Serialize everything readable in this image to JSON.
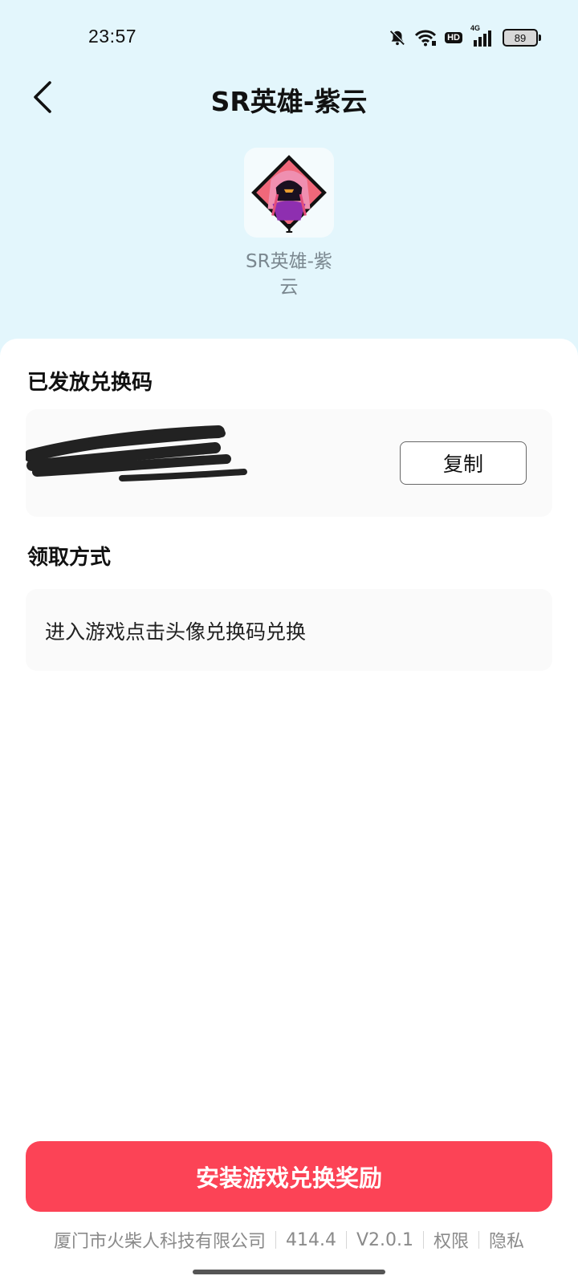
{
  "status_bar": {
    "time": "23:57",
    "network_label": "4G",
    "hd_label": "HD",
    "battery_level": "89",
    "icons": [
      "bell-muted-icon",
      "wifi-icon",
      "hd-icon",
      "signal-4g-icon",
      "battery-icon"
    ]
  },
  "header": {
    "title": "SR英雄-紫云",
    "back_icon": "chevron-left-icon"
  },
  "hero": {
    "badge_count": "1",
    "name": "SR英雄-紫云",
    "colors": {
      "frame": "#111111",
      "bg": "#f0687a",
      "hair": "#ef8fb0",
      "cloth": "#8e2fb0"
    }
  },
  "code_section": {
    "title": "已发放兑换码",
    "copy_label": "复制"
  },
  "method_section": {
    "title": "领取方式",
    "text": "进入游戏点击头像兑换码兑换"
  },
  "cta": {
    "label": "安装游戏兑换奖励",
    "color": "#fc4356"
  },
  "footer": {
    "company": "厦门市火柴人科技有限公司",
    "size": "414.4",
    "version": "V2.0.1",
    "permissions_label": "权限",
    "privacy_label": "隐私"
  }
}
